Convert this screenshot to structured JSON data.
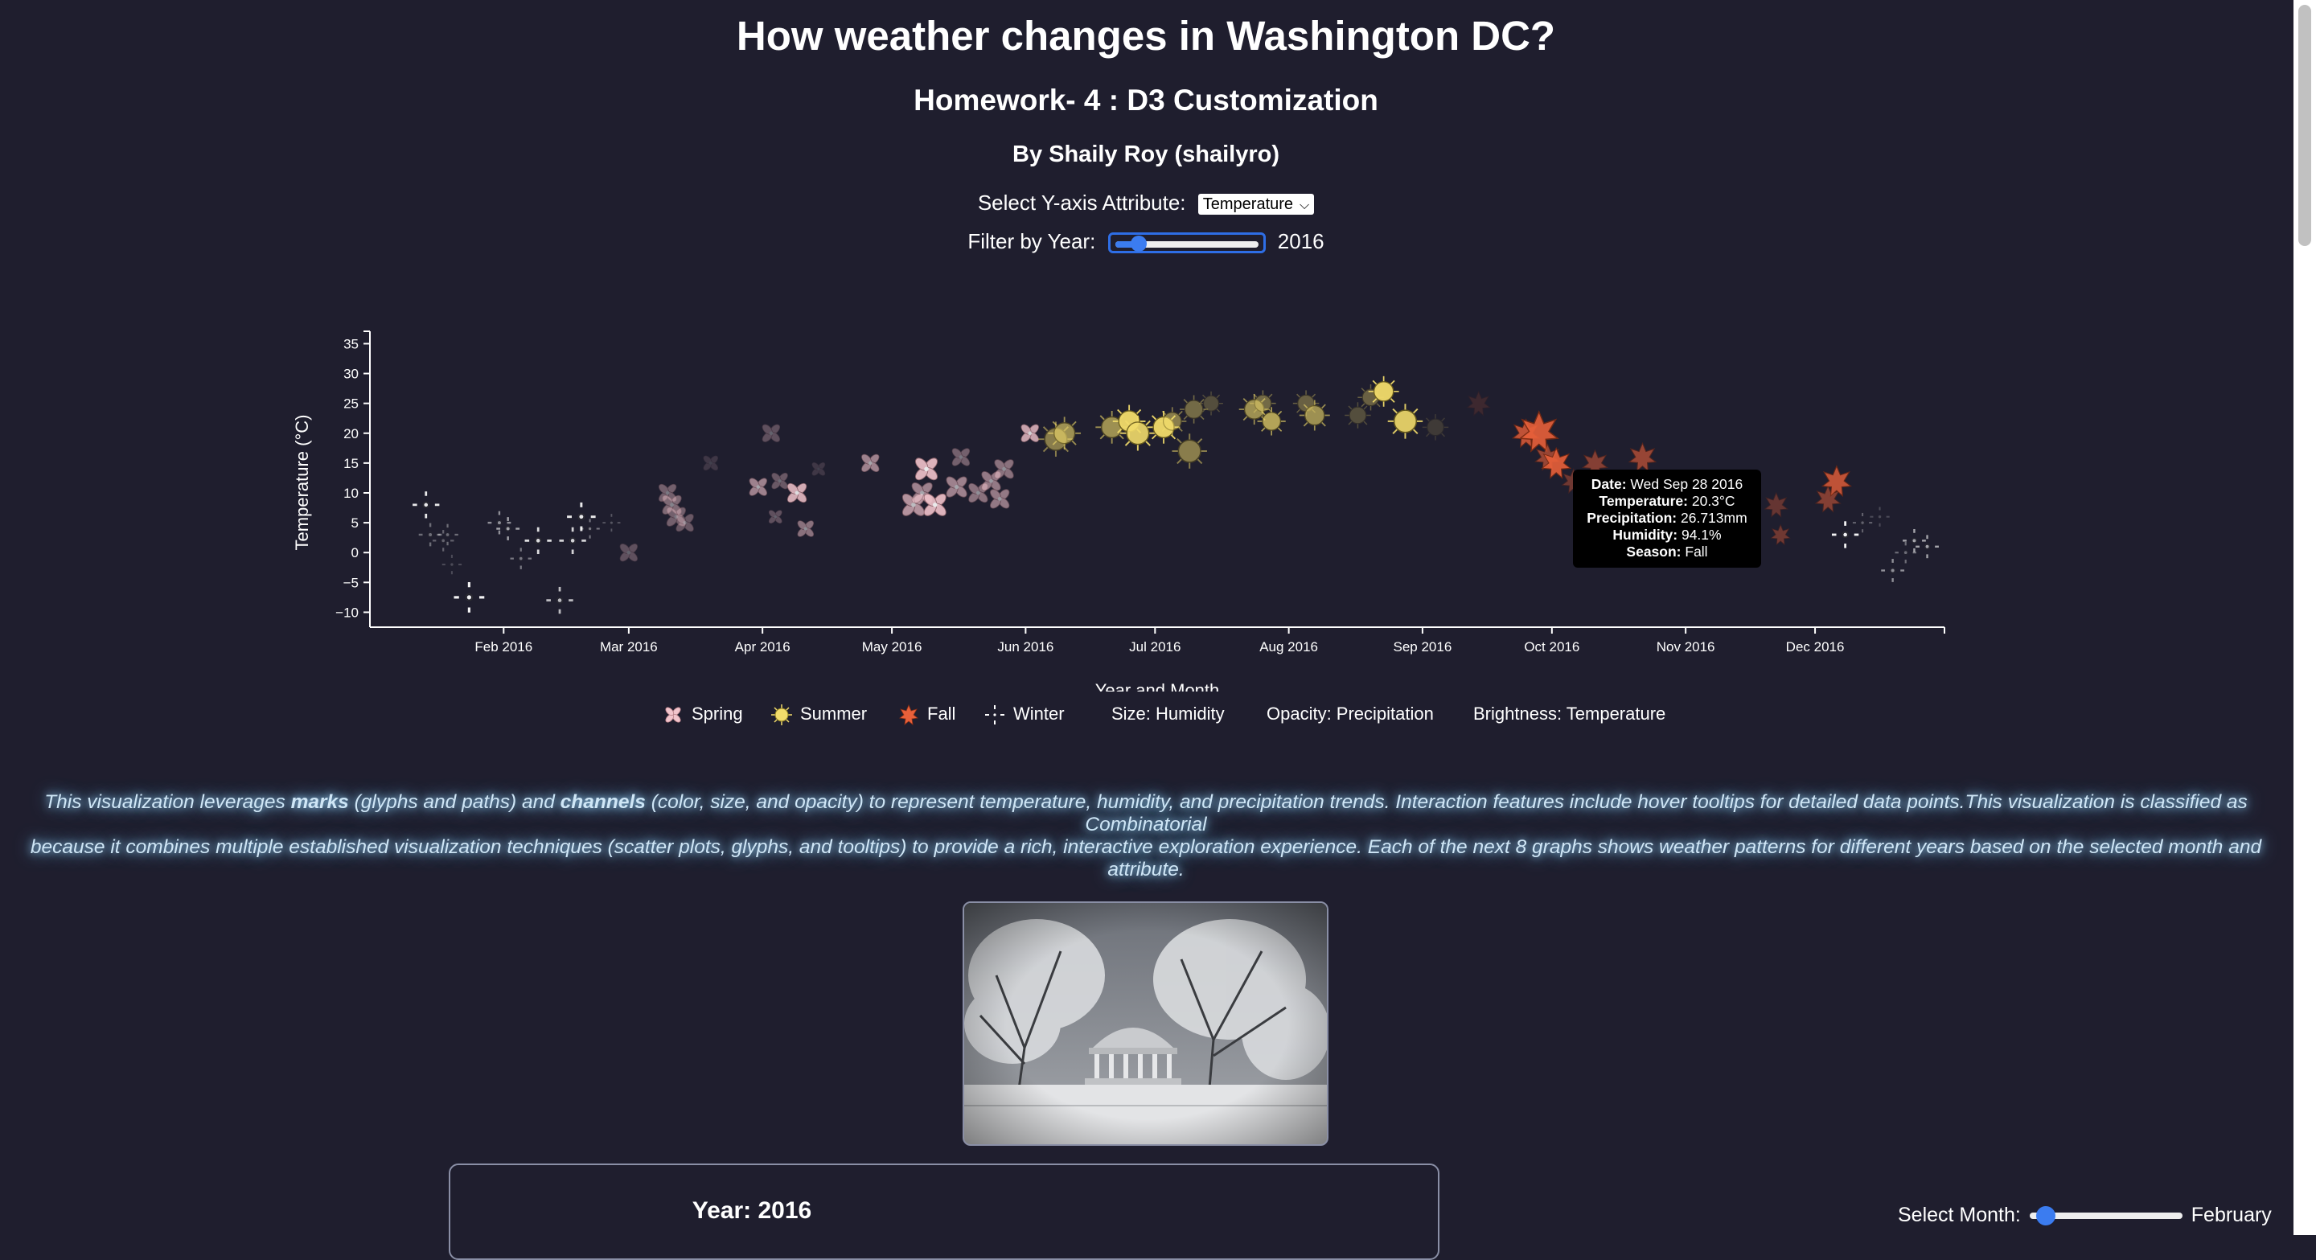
{
  "header": {
    "title": "How weather changes in Washington DC?",
    "subtitle": "Homework- 4 : D3 Customization",
    "author": "By Shaily Roy (shailyro)"
  },
  "controls": {
    "y_attr_label": "Select Y-axis Attribute:",
    "y_attr_value": "Temperature",
    "year_label": "Filter by Year:",
    "year_value": "2016",
    "year_slider_fraction": 0.12
  },
  "chart_data": {
    "type": "scatter",
    "xlabel": "Year and Month",
    "ylabel": "Temperature (°C)",
    "x_ticks": [
      "Feb 2016",
      "Mar 2016",
      "Apr 2016",
      "May 2016",
      "Jun 2016",
      "Jul 2016",
      "Aug 2016",
      "Sep 2016",
      "Oct 2016",
      "Nov 2016",
      "Dec 2016"
    ],
    "xlim": [
      "2016-01-01",
      "2016-12-31"
    ],
    "y_ticks": [
      35,
      30,
      25,
      20,
      15,
      10,
      5,
      0,
      -5,
      -10
    ],
    "ylim": [
      -12.5,
      36
    ],
    "grid": false,
    "season_colors": {
      "Spring": "#f2c4cc",
      "Summer": "#f2dc6b",
      "Fall": "#e8603a",
      "Winter": "#ffffff"
    },
    "points": [
      {
        "date": "2016-01-14",
        "temp": 8,
        "season": "Winter",
        "humidity": 70,
        "opacity": 0.9
      },
      {
        "date": "2016-01-15",
        "temp": 3,
        "season": "Winter",
        "humidity": 60,
        "opacity": 0.35
      },
      {
        "date": "2016-01-18",
        "temp": 2,
        "season": "Winter",
        "humidity": 55,
        "opacity": 0.3
      },
      {
        "date": "2016-01-19",
        "temp": 3,
        "season": "Winter",
        "humidity": 55,
        "opacity": 0.35
      },
      {
        "date": "2016-01-20",
        "temp": -2,
        "season": "Winter",
        "humidity": 50,
        "opacity": 0.2
      },
      {
        "date": "2016-01-24",
        "temp": -7.5,
        "season": "Winter",
        "humidity": 80,
        "opacity": 0.95
      },
      {
        "date": "2016-01-31",
        "temp": 5,
        "season": "Winter",
        "humidity": 60,
        "opacity": 0.5
      },
      {
        "date": "2016-02-02",
        "temp": 4,
        "season": "Winter",
        "humidity": 60,
        "opacity": 0.6
      },
      {
        "date": "2016-02-05",
        "temp": -1,
        "season": "Winter",
        "humidity": 55,
        "opacity": 0.4
      },
      {
        "date": "2016-02-09",
        "temp": 2,
        "season": "Winter",
        "humidity": 70,
        "opacity": 0.85
      },
      {
        "date": "2016-02-14",
        "temp": -8,
        "season": "Winter",
        "humidity": 70,
        "opacity": 0.7
      },
      {
        "date": "2016-02-17",
        "temp": 2,
        "season": "Winter",
        "humidity": 70,
        "opacity": 0.8
      },
      {
        "date": "2016-02-19",
        "temp": 6,
        "season": "Winter",
        "humidity": 75,
        "opacity": 0.9
      },
      {
        "date": "2016-02-21",
        "temp": 4,
        "season": "Winter",
        "humidity": 50,
        "opacity": 0.4
      },
      {
        "date": "2016-02-26",
        "temp": 5,
        "season": "Winter",
        "humidity": 45,
        "opacity": 0.25
      },
      {
        "date": "2016-03-01",
        "temp": 0,
        "season": "Spring",
        "humidity": 55,
        "opacity": 0.3
      },
      {
        "date": "2016-03-10",
        "temp": 10,
        "season": "Spring",
        "humidity": 55,
        "opacity": 0.4
      },
      {
        "date": "2016-03-11",
        "temp": 8,
        "season": "Spring",
        "humidity": 60,
        "opacity": 0.45
      },
      {
        "date": "2016-03-12",
        "temp": 6,
        "season": "Spring",
        "humidity": 60,
        "opacity": 0.4
      },
      {
        "date": "2016-03-14",
        "temp": 5,
        "season": "Spring",
        "humidity": 55,
        "opacity": 0.35
      },
      {
        "date": "2016-03-20",
        "temp": 15,
        "season": "Spring",
        "humidity": 45,
        "opacity": 0.15
      },
      {
        "date": "2016-03-31",
        "temp": 11,
        "season": "Spring",
        "humidity": 55,
        "opacity": 0.6
      },
      {
        "date": "2016-04-03",
        "temp": 20,
        "season": "Spring",
        "humidity": 55,
        "opacity": 0.3
      },
      {
        "date": "2016-04-05",
        "temp": 12,
        "season": "Spring",
        "humidity": 50,
        "opacity": 0.35
      },
      {
        "date": "2016-04-04",
        "temp": 6,
        "season": "Spring",
        "humidity": 40,
        "opacity": 0.3
      },
      {
        "date": "2016-04-09",
        "temp": 10,
        "season": "Spring",
        "humidity": 60,
        "opacity": 0.85
      },
      {
        "date": "2016-04-11",
        "temp": 4,
        "season": "Spring",
        "humidity": 50,
        "opacity": 0.5
      },
      {
        "date": "2016-04-14",
        "temp": 14,
        "season": "Spring",
        "humidity": 40,
        "opacity": 0.15
      },
      {
        "date": "2016-04-26",
        "temp": 15,
        "season": "Spring",
        "humidity": 55,
        "opacity": 0.6
      },
      {
        "date": "2016-05-06",
        "temp": 8,
        "season": "Spring",
        "humidity": 70,
        "opacity": 0.7
      },
      {
        "date": "2016-05-08",
        "temp": 10,
        "season": "Spring",
        "humidity": 65,
        "opacity": 0.6
      },
      {
        "date": "2016-05-09",
        "temp": 14,
        "season": "Spring",
        "humidity": 70,
        "opacity": 0.9
      },
      {
        "date": "2016-05-11",
        "temp": 8,
        "season": "Spring",
        "humidity": 70,
        "opacity": 0.9
      },
      {
        "date": "2016-05-16",
        "temp": 11,
        "season": "Spring",
        "humidity": 65,
        "opacity": 0.6
      },
      {
        "date": "2016-05-17",
        "temp": 16,
        "season": "Spring",
        "humidity": 55,
        "opacity": 0.4
      },
      {
        "date": "2016-05-21",
        "temp": 10,
        "season": "Spring",
        "humidity": 60,
        "opacity": 0.5
      },
      {
        "date": "2016-05-24",
        "temp": 12,
        "season": "Spring",
        "humidity": 60,
        "opacity": 0.55
      },
      {
        "date": "2016-05-26",
        "temp": 9,
        "season": "Spring",
        "humidity": 60,
        "opacity": 0.55
      },
      {
        "date": "2016-05-27",
        "temp": 14,
        "season": "Spring",
        "humidity": 60,
        "opacity": 0.5
      },
      {
        "date": "2016-06-02",
        "temp": 20,
        "season": "Spring",
        "humidity": 55,
        "opacity": 0.8
      },
      {
        "date": "2016-06-08",
        "temp": 19,
        "season": "Summer",
        "humidity": 75,
        "opacity": 0.5
      },
      {
        "date": "2016-06-10",
        "temp": 20,
        "season": "Summer",
        "humidity": 70,
        "opacity": 0.6
      },
      {
        "date": "2016-06-21",
        "temp": 21,
        "season": "Summer",
        "humidity": 70,
        "opacity": 0.6
      },
      {
        "date": "2016-06-25",
        "temp": 22,
        "season": "Summer",
        "humidity": 70,
        "opacity": 0.95
      },
      {
        "date": "2016-06-27",
        "temp": 20,
        "season": "Summer",
        "humidity": 75,
        "opacity": 0.9
      },
      {
        "date": "2016-07-03",
        "temp": 21,
        "season": "Summer",
        "humidity": 70,
        "opacity": 0.95
      },
      {
        "date": "2016-07-05",
        "temp": 22,
        "season": "Summer",
        "humidity": 60,
        "opacity": 0.5
      },
      {
        "date": "2016-07-09",
        "temp": 17,
        "season": "Summer",
        "humidity": 75,
        "opacity": 0.5
      },
      {
        "date": "2016-07-10",
        "temp": 24,
        "season": "Summer",
        "humidity": 60,
        "opacity": 0.4
      },
      {
        "date": "2016-07-14",
        "temp": 25,
        "season": "Summer",
        "humidity": 50,
        "opacity": 0.25
      },
      {
        "date": "2016-07-24",
        "temp": 24,
        "season": "Summer",
        "humidity": 65,
        "opacity": 0.6
      },
      {
        "date": "2016-07-26",
        "temp": 25,
        "season": "Summer",
        "humidity": 55,
        "opacity": 0.4
      },
      {
        "date": "2016-07-28",
        "temp": 22,
        "season": "Summer",
        "humidity": 60,
        "opacity": 0.7
      },
      {
        "date": "2016-08-05",
        "temp": 25,
        "season": "Summer",
        "humidity": 55,
        "opacity": 0.35
      },
      {
        "date": "2016-08-07",
        "temp": 23,
        "season": "Summer",
        "humidity": 65,
        "opacity": 0.6
      },
      {
        "date": "2016-08-17",
        "temp": 23,
        "season": "Summer",
        "humidity": 55,
        "opacity": 0.25
      },
      {
        "date": "2016-08-20",
        "temp": 26,
        "season": "Summer",
        "humidity": 55,
        "opacity": 0.35
      },
      {
        "date": "2016-08-23",
        "temp": 27,
        "season": "Summer",
        "humidity": 65,
        "opacity": 0.95
      },
      {
        "date": "2016-08-28",
        "temp": 22,
        "season": "Summer",
        "humidity": 75,
        "opacity": 0.9
      },
      {
        "date": "2016-09-04",
        "temp": 21,
        "season": "Summer",
        "humidity": 55,
        "opacity": 0.15
      },
      {
        "date": "2016-09-14",
        "temp": 25,
        "season": "Fall",
        "humidity": 55,
        "opacity": 0.15
      },
      {
        "date": "2016-09-25",
        "temp": 20,
        "season": "Fall",
        "humidity": 65,
        "opacity": 0.8
      },
      {
        "date": "2016-09-28",
        "temp": 20.3,
        "season": "Fall",
        "humidity": 94.1,
        "opacity": 0.9
      },
      {
        "date": "2016-09-30",
        "temp": 16,
        "season": "Fall",
        "humidity": 60,
        "opacity": 0.6
      },
      {
        "date": "2016-10-02",
        "temp": 15,
        "season": "Fall",
        "humidity": 70,
        "opacity": 0.9
      },
      {
        "date": "2016-10-06",
        "temp": 12,
        "season": "Fall",
        "humidity": 55,
        "opacity": 0.4
      },
      {
        "date": "2016-10-11",
        "temp": 15,
        "season": "Fall",
        "humidity": 60,
        "opacity": 0.5
      },
      {
        "date": "2016-10-22",
        "temp": 16,
        "season": "Fall",
        "humidity": 65,
        "opacity": 0.6
      },
      {
        "date": "2016-11-22",
        "temp": 8,
        "season": "Fall",
        "humidity": 55,
        "opacity": 0.35
      },
      {
        "date": "2016-11-23",
        "temp": 3,
        "season": "Fall",
        "humidity": 45,
        "opacity": 0.4
      },
      {
        "date": "2016-12-04",
        "temp": 9,
        "season": "Fall",
        "humidity": 60,
        "opacity": 0.5
      },
      {
        "date": "2016-12-06",
        "temp": 12,
        "season": "Fall",
        "humidity": 70,
        "opacity": 0.8
      },
      {
        "date": "2016-12-08",
        "temp": 3,
        "season": "Winter",
        "humidity": 70,
        "opacity": 0.95
      },
      {
        "date": "2016-12-12",
        "temp": 5,
        "season": "Winter",
        "humidity": 50,
        "opacity": 0.3
      },
      {
        "date": "2016-12-16",
        "temp": 6,
        "season": "Winter",
        "humidity": 50,
        "opacity": 0.2
      },
      {
        "date": "2016-12-19",
        "temp": -3,
        "season": "Winter",
        "humidity": 60,
        "opacity": 0.5
      },
      {
        "date": "2016-12-22",
        "temp": 0,
        "season": "Winter",
        "humidity": 55,
        "opacity": 0.35
      },
      {
        "date": "2016-12-24",
        "temp": 2,
        "season": "Winter",
        "humidity": 60,
        "opacity": 0.6
      },
      {
        "date": "2016-12-27",
        "temp": 1,
        "season": "Winter",
        "humidity": 60,
        "opacity": 0.6
      }
    ]
  },
  "tooltip": {
    "date_label": "Date:",
    "date_value": "Wed Sep 28 2016",
    "temp_label": "Temperature:",
    "temp_value": "20.3°C",
    "precip_label": "Precipitation:",
    "precip_value": "26.713mm",
    "humidity_label": "Humidity:",
    "humidity_value": "94.1%",
    "season_label": "Season:",
    "season_value": "Fall"
  },
  "legend": {
    "spring": "Spring",
    "summer": "Summer",
    "fall": "Fall",
    "winter": "Winter",
    "size": "Size: Humidity",
    "opacity": "Opacity: Precipitation",
    "brightness": "Brightness: Temperature"
  },
  "description": {
    "p1": "This visualization leverages ",
    "b1": "marks",
    "p2": " (glyphs and paths) and ",
    "b2": "channels",
    "p3": " (color, size, and opacity) to represent temperature, humidity, and precipitation trends. Interaction features include hover tooltips for detailed data points.This visualization is classified as Combinatorial",
    "line2": "because it combines multiple established visualization techniques (scatter plots, glyphs, and tooltips) to provide a rich, interactive exploration experience. Each of the next 8 graphs shows weather patterns for different years based on the selected month and attribute."
  },
  "year_panel": {
    "title": "Year: 2016"
  },
  "month_control": {
    "label": "Select Month:",
    "value": "February",
    "slider_fraction": 0.05
  }
}
